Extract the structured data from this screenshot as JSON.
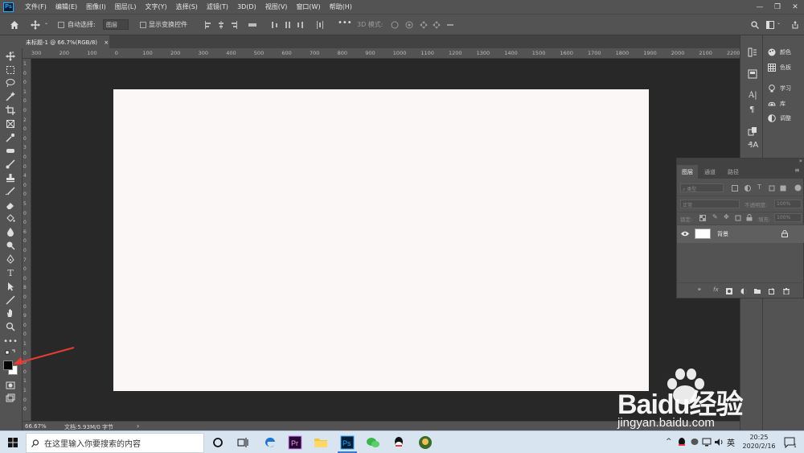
{
  "menubar": {
    "items": [
      "文件(F)",
      "编辑(E)",
      "图像(I)",
      "图层(L)",
      "文字(Y)",
      "选择(S)",
      "滤镜(T)",
      "3D(D)",
      "视图(V)",
      "窗口(W)",
      "帮助(H)"
    ]
  },
  "options": {
    "auto_select": "自动选择:",
    "layer_dropdown": "图层",
    "show_transform": "显示变换控件",
    "mode_3d": "3D 模式:"
  },
  "document": {
    "tab_title": "未标题-1 @ 66.7%(RGB/8)",
    "close": "×"
  },
  "ruler": {
    "h_ticks": [
      "300",
      "200",
      "100",
      "0",
      "100",
      "200",
      "300",
      "400",
      "500",
      "600",
      "700",
      "800",
      "900",
      "1000",
      "1100",
      "1200",
      "1300",
      "1400",
      "1500",
      "1600",
      "1700",
      "1800",
      "1900",
      "2000",
      "2100",
      "2200"
    ],
    "v_ticks": [
      "1",
      "0",
      "0",
      "1",
      "0",
      "0",
      "2",
      "0",
      "0",
      "3",
      "0",
      "0",
      "4",
      "0",
      "0",
      "5",
      "0",
      "0",
      "6",
      "0",
      "0",
      "7",
      "0",
      "0",
      "8",
      "0",
      "0",
      "9",
      "0",
      "0",
      "1",
      "0",
      "0",
      "0",
      "1",
      "1",
      "0",
      "0"
    ]
  },
  "status": {
    "zoom": "66.67%",
    "doc_size": "文档:5.93M/0 字节",
    "arrow": "›"
  },
  "right_panels": {
    "items": [
      "颜色",
      "色板",
      "学习",
      "库",
      "调整"
    ]
  },
  "layers_panel": {
    "tabs": [
      "图层",
      "通道",
      "路径"
    ],
    "filter_placeholder": "类型",
    "blend_mode": "正常",
    "opacity_label": "不透明度:",
    "opacity_value": "100%",
    "lock_label": "锁定:",
    "fill_label": "填充:",
    "fill_value": "100%",
    "layer_name": "背景"
  },
  "taskbar": {
    "search_placeholder": "在这里输入你要搜索的内容",
    "ime": "英",
    "time": "20:25",
    "date": "2020/2/16",
    "notif_count": "1"
  },
  "watermark": {
    "brand": "Baidu经验",
    "url": "jingyan.baidu.com"
  },
  "colors": {
    "canvas": "#fbf7f6",
    "workspace": "#282828",
    "panel": "#535353",
    "arrow": "#e63b36",
    "ps_blue": "#31a8ff"
  }
}
